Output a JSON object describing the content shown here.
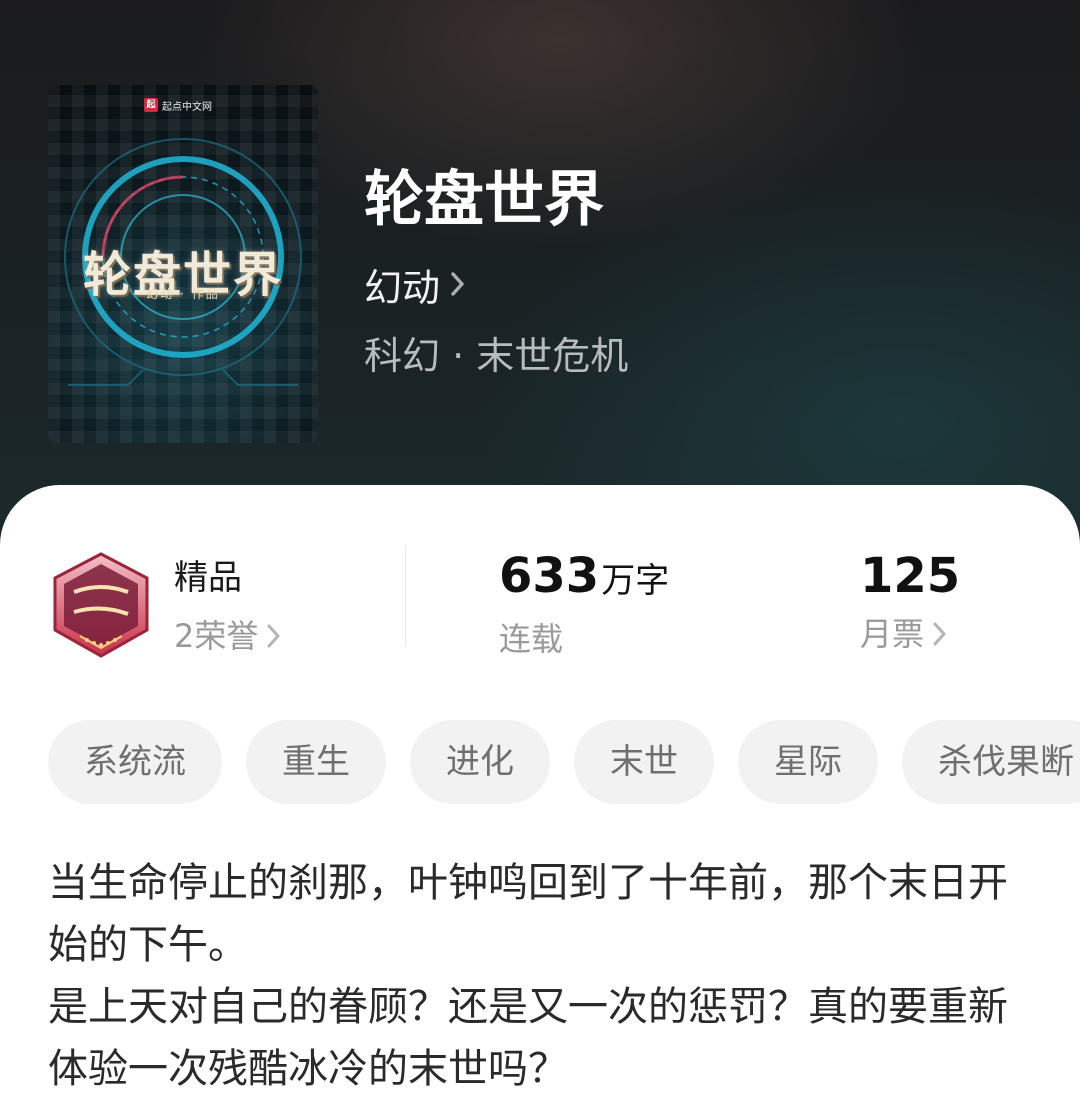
{
  "book": {
    "title": "轮盘世界",
    "author": "幻动",
    "genre": "科幻 · 末世危机",
    "cover": {
      "publisher": "起点中文网",
      "logo_mark": "起",
      "title_art": "轮盘世界",
      "author_line": "幻动 · 作品"
    }
  },
  "stats": {
    "quality": {
      "label": "精品",
      "honors": "2荣誉"
    },
    "length": {
      "value": "633",
      "unit": "万字",
      "status": "连载"
    },
    "monthly": {
      "value": "125",
      "label": "月票"
    }
  },
  "tags": [
    "系统流",
    "重生",
    "进化",
    "末世",
    "星际",
    "杀伐果断"
  ],
  "synopsis": {
    "line1": "当生命停止的刹那，叶钟鸣回到了十年前，那个末日开始的下午。",
    "line2": "是上天对自己的眷顾？还是又一次的惩罚？真的要重新体验一次残酷冰冷的末世吗？"
  },
  "colors": {
    "hero_dark": "#1a2224",
    "accent_cyan": "#1fb7d8",
    "badge_red": "#c8304a",
    "tag_bg": "#f2f2f2"
  }
}
